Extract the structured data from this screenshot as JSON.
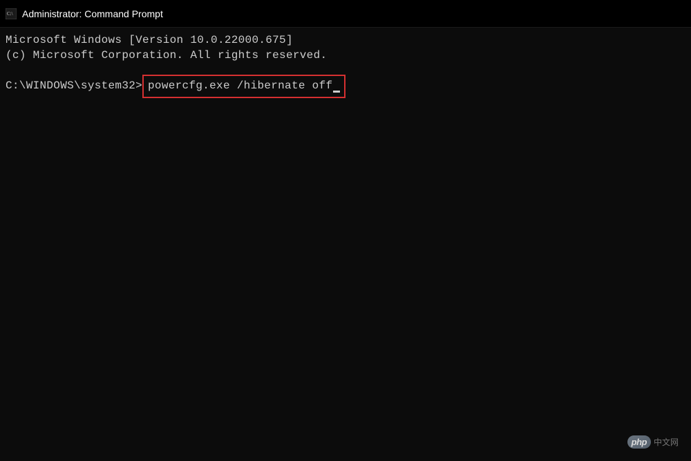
{
  "window": {
    "title": "Administrator: Command Prompt"
  },
  "terminal": {
    "header_line1": "Microsoft Windows [Version 10.0.22000.675]",
    "header_line2": "(c) Microsoft Corporation. All rights reserved.",
    "prompt": "C:\\WINDOWS\\system32>",
    "command": "powercfg.exe /hibernate off"
  },
  "watermark": {
    "logo_text": "php",
    "suffix_text": "中文网"
  }
}
